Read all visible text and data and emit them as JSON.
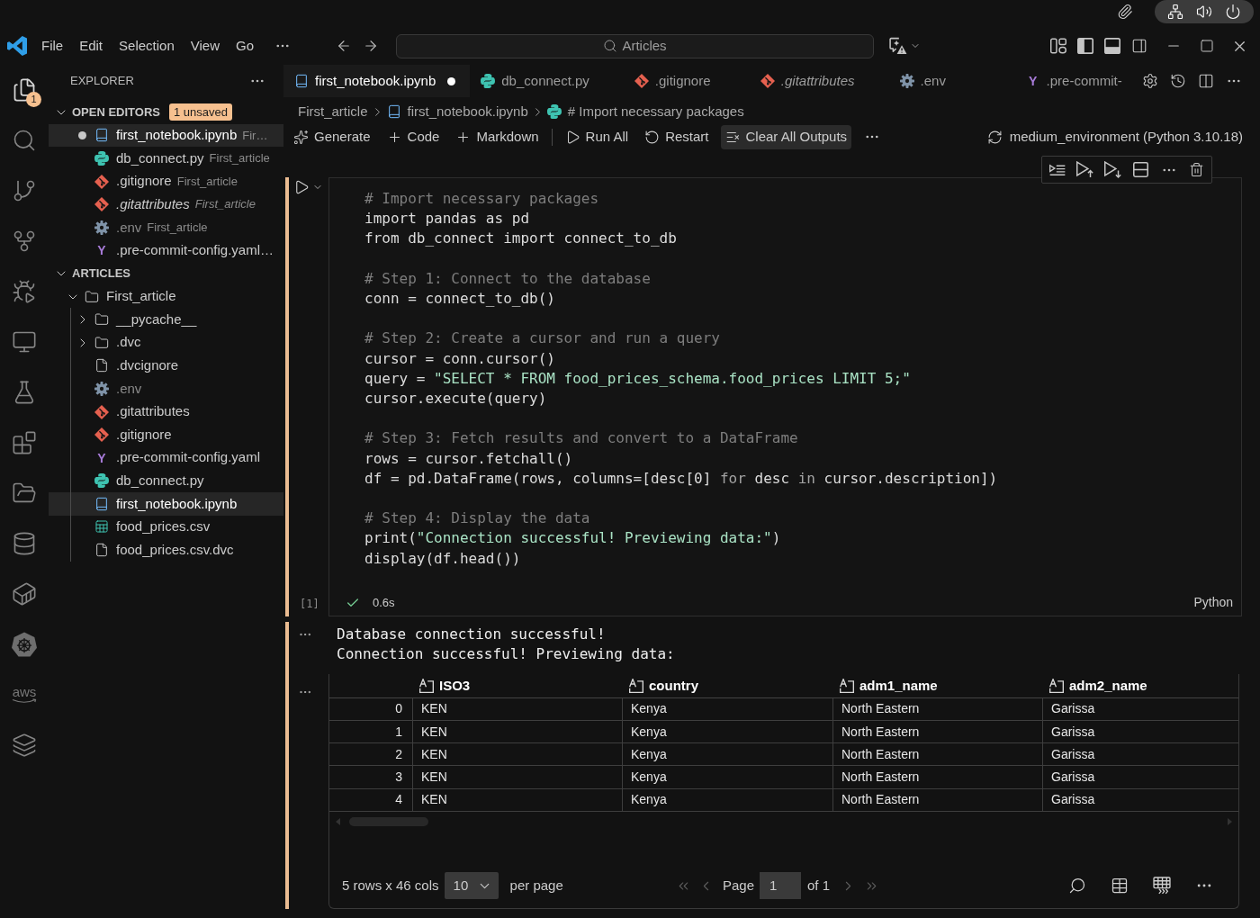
{
  "title_bar": {
    "menu": [
      {
        "label": "File"
      },
      {
        "label": "Edit"
      },
      {
        "label": "Selection"
      },
      {
        "label": "View"
      },
      {
        "label": "Go"
      }
    ],
    "command_center": {
      "label": "Articles"
    }
  },
  "activity_bar": {
    "badge": "1",
    "logo_text": "aws"
  },
  "sidebar": {
    "title": "EXPLORER",
    "open_editors": {
      "title": "OPEN EDITORS",
      "expanded": true,
      "badge": "1 unsaved",
      "items": [
        {
          "name": "first_notebook.ipynb",
          "detail": "Fir…",
          "kind": "notebook",
          "dirty": true,
          "selected": true,
          "preview": false,
          "ignored": false
        },
        {
          "name": "db_connect.py",
          "detail": "First_article",
          "kind": "python",
          "dirty": false,
          "selected": false,
          "preview": false,
          "ignored": false
        },
        {
          "name": ".gitignore",
          "detail": "First_article",
          "kind": "git",
          "dirty": false,
          "selected": false,
          "preview": false,
          "ignored": false
        },
        {
          "name": ".gitattributes",
          "detail": "First_article",
          "kind": "git",
          "dirty": false,
          "selected": false,
          "preview": true,
          "ignored": false
        },
        {
          "name": ".env",
          "detail": "First_article",
          "kind": "settings",
          "dirty": false,
          "selected": false,
          "preview": false,
          "ignored": true
        },
        {
          "name": ".pre-commit-config.yaml…",
          "kind": "yaml",
          "glyph": "Y",
          "dirty": false,
          "selected": false,
          "preview": false,
          "ignored": false
        }
      ]
    },
    "folder": {
      "title": "ARTICLES",
      "expanded": true,
      "tree": [
        {
          "name": "First_article",
          "kind": "folder",
          "expanded": true,
          "selected": false,
          "ignored": false,
          "children": [
            {
              "name": "__pycache__",
              "kind": "folder",
              "expanded": false,
              "selected": false,
              "ignored": false
            },
            {
              "name": ".dvc",
              "kind": "folder",
              "expanded": false,
              "selected": false,
              "ignored": false
            },
            {
              "name": ".dvcignore",
              "kind": "file",
              "selected": false,
              "ignored": false
            },
            {
              "name": ".env",
              "kind": "settings",
              "selected": false,
              "ignored": true
            },
            {
              "name": ".gitattributes",
              "kind": "git",
              "selected": false,
              "ignored": false
            },
            {
              "name": ".gitignore",
              "kind": "git",
              "selected": false,
              "ignored": false
            },
            {
              "name": ".pre-commit-config.yaml",
              "kind": "yaml",
              "glyph": "Y",
              "selected": false,
              "ignored": false
            },
            {
              "name": "db_connect.py",
              "kind": "python",
              "selected": false,
              "ignored": false
            },
            {
              "name": "first_notebook.ipynb",
              "kind": "notebook",
              "selected": true,
              "ignored": false
            },
            {
              "name": "food_prices.csv",
              "kind": "csv",
              "selected": false,
              "ignored": false
            },
            {
              "name": "food_prices.csv.dvc",
              "kind": "file",
              "selected": false,
              "ignored": false
            }
          ]
        }
      ]
    }
  },
  "editor": {
    "tabs": [
      {
        "label": "first_notebook.ipynb",
        "kind": "notebook",
        "selected": true,
        "dirty": true,
        "preview": false
      },
      {
        "label": "db_connect.py",
        "kind": "python",
        "selected": false,
        "dirty": false,
        "preview": false
      },
      {
        "label": ".gitignore",
        "kind": "git",
        "selected": false,
        "dirty": false,
        "preview": false
      },
      {
        "label": ".gitattributes",
        "kind": "git",
        "selected": false,
        "dirty": false,
        "preview": true
      },
      {
        "label": ".env",
        "kind": "settings",
        "selected": false,
        "dirty": false,
        "preview": false
      },
      {
        "label": ".pre-commit-",
        "kind": "yaml",
        "glyph": "Y",
        "selected": false,
        "dirty": false,
        "preview": false
      }
    ],
    "breadcrumb": [
      {
        "label": "First_article"
      },
      {
        "label": "first_notebook.ipynb",
        "kind": "notebook"
      },
      {
        "label": "# Import necessary packages",
        "kind": "python"
      }
    ],
    "toolbar": {
      "insert": [
        {
          "label": "Generate",
          "kind": "generate",
          "hovered": false
        },
        {
          "label": "Code",
          "kind": "add",
          "hovered": false
        },
        {
          "label": "Markdown",
          "kind": "add",
          "hovered": false
        }
      ],
      "actions": [
        {
          "label": "Run All",
          "kind": "run",
          "hovered": false
        },
        {
          "label": "Restart",
          "kind": "restart",
          "hovered": false
        },
        {
          "label": "Clear All Outputs",
          "kind": "clear",
          "hovered": true
        }
      ]
    },
    "kernel": "medium_environment (Python 3.10.18)",
    "cell": {
      "focused": true,
      "execution_count": "[1]",
      "succeeded": true,
      "duration": "0.6s",
      "language": "Python",
      "code_blocks": [
        [
          [
            {
              "kind": "comment",
              "text": "# Import necessary packages"
            }
          ],
          [
            {
              "kind": "plain",
              "text": "import pandas as pd"
            }
          ],
          [
            {
              "kind": "plain",
              "text": "from db_connect import connect_to_db"
            }
          ]
        ],
        [
          [
            {
              "kind": "comment",
              "text": "# Step 1: Connect to the database"
            }
          ],
          [
            {
              "kind": "plain",
              "text": "conn = connect_to_db()"
            }
          ]
        ],
        [
          [
            {
              "kind": "comment",
              "text": "# Step 2: Create a cursor and run a query"
            }
          ],
          [
            {
              "kind": "plain",
              "text": "cursor = conn.cursor()"
            }
          ],
          [
            {
              "kind": "plain",
              "text": "query = "
            },
            {
              "kind": "string",
              "text": "\"SELECT * FROM food_prices_schema.food_prices LIMIT 5;\""
            }
          ],
          [
            {
              "kind": "plain",
              "text": "cursor.execute(query)"
            }
          ]
        ],
        [
          [
            {
              "kind": "comment",
              "text": "# Step 3: Fetch results and convert to a DataFrame"
            }
          ],
          [
            {
              "kind": "plain",
              "text": "rows = cursor.fetchall()"
            }
          ],
          [
            {
              "kind": "plain",
              "text": "df = pd.DataFrame(rows, columns=[desc[0] "
            },
            {
              "kind": "keyword",
              "text": "for"
            },
            {
              "kind": "plain",
              "text": " desc "
            },
            {
              "kind": "keyword",
              "text": "in"
            },
            {
              "kind": "plain",
              "text": " cursor.description])"
            }
          ]
        ],
        [
          [
            {
              "kind": "comment",
              "text": "# Step 4: Display the data"
            }
          ],
          [
            {
              "kind": "plain",
              "text": "print("
            },
            {
              "kind": "string",
              "text": "\"Connection successful! Previewing data:\""
            },
            {
              "kind": "plain",
              "text": ")"
            }
          ],
          [
            {
              "kind": "plain",
              "text": "display(df.head())"
            }
          ]
        ]
      ],
      "outputs": [
        {
          "kind": "stream",
          "lines": [
            "Database connection successful!",
            "Connection successful! Previewing data:"
          ]
        },
        {
          "kind": "table",
          "columns": [
            "ISO3",
            "country",
            "adm1_name",
            "adm2_name"
          ],
          "rows": [
            {
              "index": "0",
              "cells": [
                "KEN",
                "Kenya",
                "North Eastern",
                "Garissa"
              ]
            },
            {
              "index": "1",
              "cells": [
                "KEN",
                "Kenya",
                "North Eastern",
                "Garissa"
              ]
            },
            {
              "index": "2",
              "cells": [
                "KEN",
                "Kenya",
                "North Eastern",
                "Garissa"
              ]
            },
            {
              "index": "3",
              "cells": [
                "KEN",
                "Kenya",
                "North Eastern",
                "Garissa"
              ]
            },
            {
              "index": "4",
              "cells": [
                "KEN",
                "Kenya",
                "North Eastern",
                "Garissa"
              ]
            }
          ],
          "summary": "5 rows x 46 cols",
          "page_size": "10",
          "page_size_label": "per page",
          "pager": {
            "label": "Page",
            "value": "1",
            "total": "of 1",
            "can_go_back": false,
            "can_go_forward": false
          }
        }
      ]
    }
  }
}
